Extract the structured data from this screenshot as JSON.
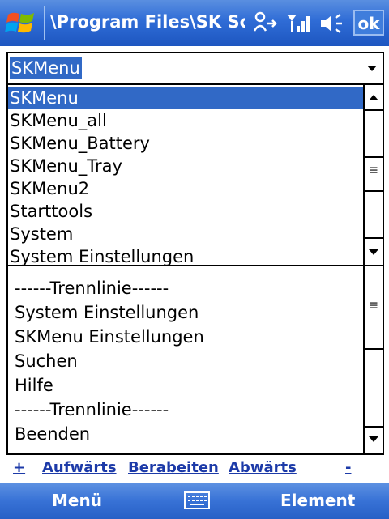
{
  "title_bar": {
    "title": "\\Program Files\\SK Sc",
    "ok_label": "ok",
    "icons": [
      "start-logo-icon",
      "connectivity-icon",
      "signal-icon",
      "volume-icon"
    ]
  },
  "combo": {
    "value": "SKMenu"
  },
  "dropdown": {
    "items": [
      "SKMenu",
      "SKMenu_all",
      "SKMenu_Battery",
      "SKMenu_Tray",
      "SKMenu2",
      "Starttools",
      "System",
      "System Einstellungen"
    ],
    "selected_index": 0
  },
  "main_list": {
    "items": [
      "------Trennlinie------",
      "System Einstellungen",
      "SKMenu Einstellungen",
      "Suchen",
      "Hilfe",
      "------Trennlinie------",
      "Beenden"
    ]
  },
  "link_bar": {
    "plus": "+",
    "up": "Aufwärts",
    "edit": "Berabeiten",
    "down": "Abwärts",
    "minus": "-"
  },
  "softkeys": {
    "left": "Menü",
    "right": "Element"
  },
  "colors": {
    "titlebar": "#2f6cd6",
    "selection": "#3169c6",
    "link": "#1c3aa8"
  }
}
